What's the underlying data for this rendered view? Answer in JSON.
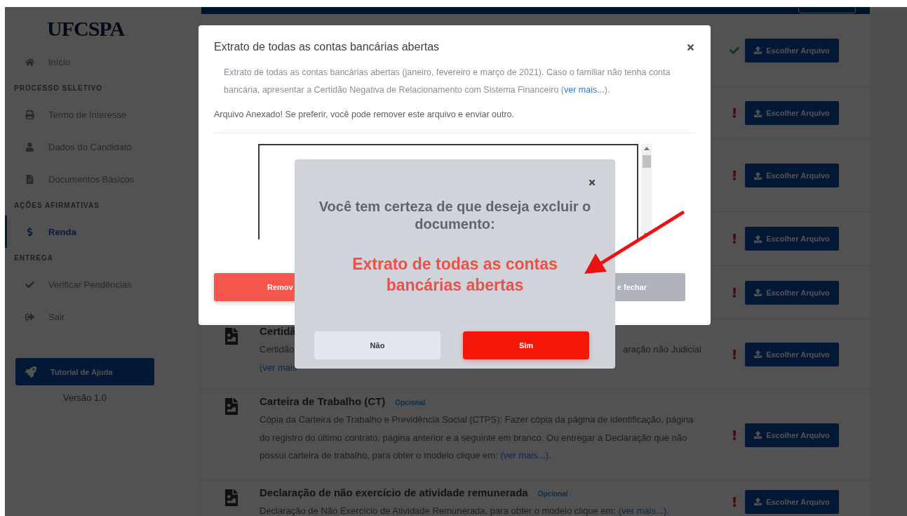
{
  "sidebar": {
    "logo": "UFCSPA",
    "items": [
      {
        "kind": "link",
        "label": "Início",
        "selected": false
      },
      {
        "kind": "section",
        "label": "PROCESSO SELETIVO"
      },
      {
        "kind": "link",
        "label": "Termo de Interesse",
        "selected": false
      },
      {
        "kind": "link",
        "label": "Dados do Candidato",
        "selected": false
      },
      {
        "kind": "link",
        "label": "Documentos Básicos",
        "selected": false
      },
      {
        "kind": "section",
        "label": "AÇÕES AFIRMATIVAS"
      },
      {
        "kind": "link",
        "label": "Renda",
        "selected": true
      },
      {
        "kind": "section",
        "label": "ENTREGA"
      },
      {
        "kind": "link",
        "label": "Verificar Pendências",
        "selected": false
      },
      {
        "kind": "link",
        "label": "Sair",
        "selected": false
      }
    ],
    "help_button": "Tutorial de Ajuda",
    "version": "Versão 1.0"
  },
  "documents": [
    {
      "uploaded": true,
      "button": "Escolher Arquivo"
    },
    {
      "uploaded": false,
      "button": "Escolher Arquivo"
    },
    {
      "uploaded": false,
      "button": "Escolher Arquivo"
    },
    {
      "uploaded": false,
      "button": "Escolher Arquivo"
    },
    {
      "uploaded": false,
      "button": "Escolher Arquivo"
    },
    {
      "uploaded": false,
      "button": "Escolher Arquivo",
      "title": "Certidã",
      "text_fragments": [
        "Certidão",
        "aração não Judicial"
      ],
      "link_fragment": "(ver mais"
    },
    {
      "uploaded": false,
      "button": "Escolher Arquivo",
      "title": "Carteira de Trabalho (CT)",
      "badge": "Opcional",
      "description": "Cópia da Carteira de Trabalho e Previdência Social (CTPS): Fazer cópia da página de identificação, página do registro do último contrato, página anterior e a seguinte em branco. Ou entregar a Declaração que não possui carteira de trabalho, para obter o modelo clique em: ",
      "link": "(ver mais...)",
      "after": "."
    },
    {
      "uploaded": false,
      "button": "Escolher Arquivo",
      "title": "Declaração de não exercício de atividade remunerada",
      "badge": "Opcional",
      "description": "Declaração de Não Exercício de Atividade Remunerada, para obter o modelo clique em: ",
      "link": "(ver mais...)",
      "after": "."
    }
  ],
  "upload_dialog": {
    "title": "Extrato de todas as contas bancárias abertas",
    "description": "Extrato de todas as contas bancárias abertas (janeiro, fevereiro e março de 2021). Caso o familiar não tenha conta bancária, apresentar a Certidão Negativa de Relacionamento com Sistema Financeiro (",
    "link": "ver mais...",
    "after": ").",
    "notice": "Arquivo Anexado! Se preferir, você pode remover este arquivo e enviar outro.",
    "remove_button": "Remov",
    "close_button": "e fechar"
  },
  "confirm_dialog": {
    "question": "Você tem certeza de que deseja excluir o documento:",
    "document": "Extrato de todas as contas bancárias abertas",
    "no_button": "Não",
    "yes_button": "Sim"
  }
}
